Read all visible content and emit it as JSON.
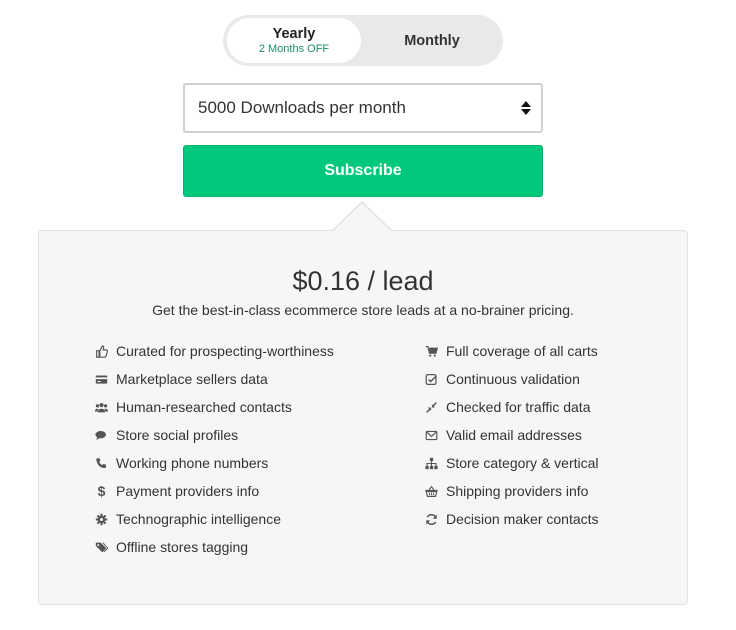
{
  "billing_toggle": {
    "yearly_label": "Yearly",
    "yearly_sublabel": "2 Months OFF",
    "monthly_label": "Monthly",
    "selected": "Yearly"
  },
  "plan_select": {
    "value": "5000 Downloads per month"
  },
  "subscribe_label": "Subscribe",
  "pricing": {
    "price": "$0.16 / lead",
    "tagline": "Get the best-in-class ecommerce store leads at a no-brainer pricing."
  },
  "features_left": [
    {
      "icon": "thumbs-up-icon",
      "label": "Curated for prospecting-worthiness"
    },
    {
      "icon": "credit-card-icon",
      "label": "Marketplace sellers data"
    },
    {
      "icon": "users-icon",
      "label": "Human-researched contacts"
    },
    {
      "icon": "comments-icon",
      "label": "Store social profiles"
    },
    {
      "icon": "phone-icon",
      "label": "Working phone numbers"
    },
    {
      "icon": "dollar-icon",
      "label": "Payment providers info"
    },
    {
      "icon": "cog-icon",
      "label": "Technographic intelligence"
    },
    {
      "icon": "tags-icon",
      "label": "Offline stores tagging"
    }
  ],
  "features_right": [
    {
      "icon": "cart-icon",
      "label": "Full coverage of all carts"
    },
    {
      "icon": "check-square-icon",
      "label": "Continuous validation"
    },
    {
      "icon": "compress-icon",
      "label": "Checked for traffic data"
    },
    {
      "icon": "envelope-icon",
      "label": "Valid email addresses"
    },
    {
      "icon": "sitemap-icon",
      "label": "Store category & vertical"
    },
    {
      "icon": "basket-icon",
      "label": "Shipping providers info"
    },
    {
      "icon": "refresh-icon",
      "label": "Decision maker contacts"
    }
  ],
  "colors": {
    "accent_green": "#00c97c",
    "sublabel_green": "#1a8f5e",
    "panel_bg": "#f6f6f6"
  }
}
